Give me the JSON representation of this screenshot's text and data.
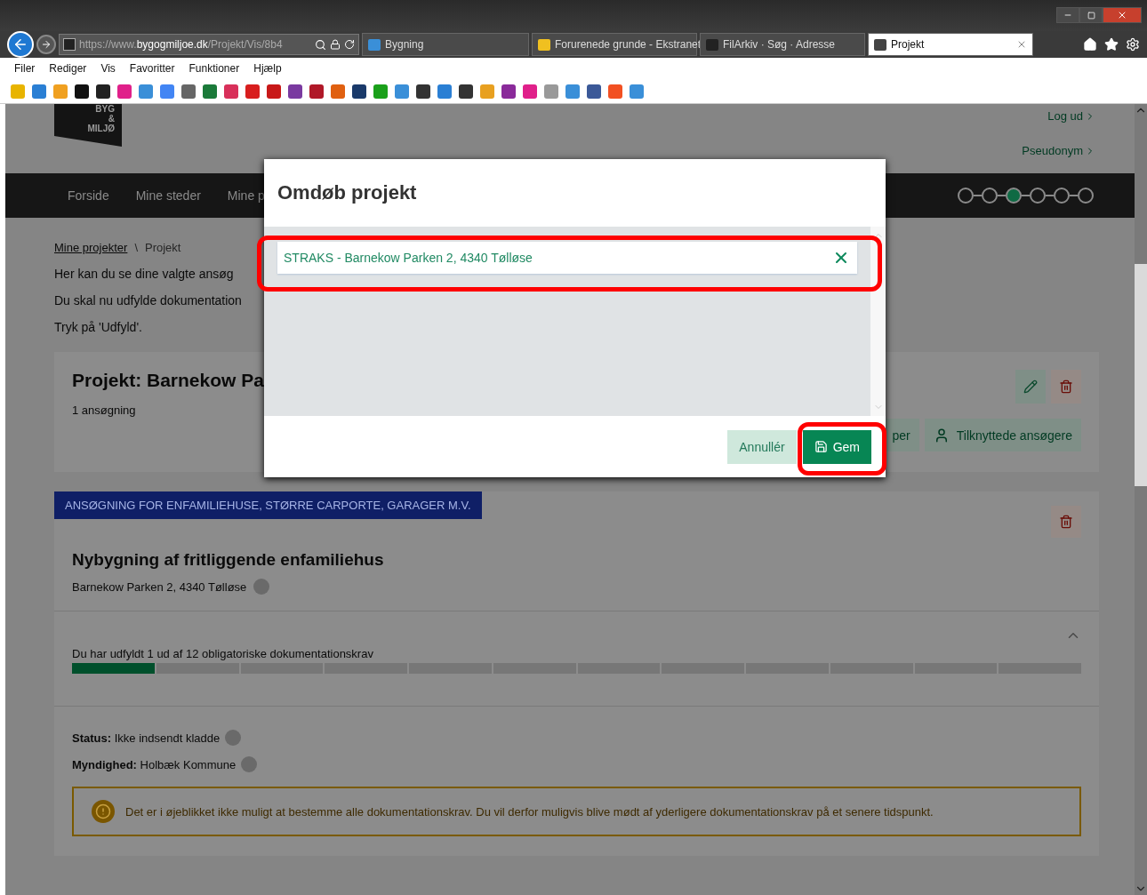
{
  "browser": {
    "address": {
      "prefix": "https://www.",
      "domain": "bygogmiljoe.dk",
      "path": "/Projekt/Vis/8b4"
    },
    "tabs": [
      {
        "label": "Bygning",
        "selected": false
      },
      {
        "label": "Forurenede grunde - Ekstranet",
        "selected": false
      },
      {
        "label": "FilArkiv · Søg · Adresse",
        "selected": false
      },
      {
        "label": "Projekt",
        "selected": true
      }
    ],
    "menu": [
      "Filer",
      "Rediger",
      "Vis",
      "Favoritter",
      "Funktioner",
      "Hjælp"
    ],
    "favorites": [
      {
        "color": "#e8b400"
      },
      {
        "color": "#2a7fd4"
      },
      {
        "color": "#f0a020"
      },
      {
        "color": "#111111"
      },
      {
        "color": "#222222"
      },
      {
        "color": "#e0208a"
      },
      {
        "color": "#3a8fd8"
      },
      {
        "color": "#4285f4"
      },
      {
        "color": "#666666"
      },
      {
        "color": "#1b7a3a"
      },
      {
        "color": "#d8305a"
      },
      {
        "color": "#d81e1e"
      },
      {
        "color": "#c81818"
      },
      {
        "color": "#7a3aa0"
      },
      {
        "color": "#b01828"
      },
      {
        "color": "#e06010"
      },
      {
        "color": "#1a3a6a"
      },
      {
        "color": "#1aa01a"
      },
      {
        "color": "#3a8fd8"
      },
      {
        "color": "#333333"
      },
      {
        "color": "#2a7fd4"
      },
      {
        "color": "#333333"
      },
      {
        "color": "#e8a020"
      },
      {
        "color": "#8a2a9a"
      },
      {
        "color": "#e0208a"
      },
      {
        "color": "#999999"
      },
      {
        "color": "#3a8fd8"
      },
      {
        "color": "#3b5998"
      },
      {
        "color": "#f25022"
      },
      {
        "color": "#3a8fd8"
      }
    ]
  },
  "header": {
    "logo": [
      "BYG",
      "&",
      "MILJØ"
    ],
    "links": [
      "Log ud",
      "Pseudonym"
    ]
  },
  "nav": {
    "items": [
      "Forside",
      "Mine steder",
      "Mine p"
    ],
    "steps": [
      {
        "selected": false
      },
      {
        "selected": false
      },
      {
        "selected": true
      },
      {
        "selected": false
      },
      {
        "selected": false
      },
      {
        "selected": false
      }
    ]
  },
  "breadcrumb": {
    "items": [
      "Mine projekter",
      "Projekt"
    ],
    "separator": "\\"
  },
  "intro": [
    "Her kan du se dine valgte ansøg",
    "Du skal nu udfylde dokumentation",
    "Tryk på 'Udfyld'."
  ],
  "project_card": {
    "title": "Projekt: Barnekow Pa",
    "subtitle": "1 ansøgning",
    "buttons": [
      {
        "label": "per",
        "kind": "plain"
      },
      {
        "label": "Tilknyttede ansøgere",
        "kind": "user"
      }
    ]
  },
  "application_card": {
    "tag": "ANSØGNING FOR ENFAMILIEHUSE, STØRRE CARPORTE, GARAGER M.V.",
    "title": "Nybygning af fritliggende enfamiliehus",
    "address": "Barnekow Parken 2, 4340 Tølløse",
    "progress": {
      "text": "Du har udfyldt 1 ud af 12 obligatoriske dokumentationskrav",
      "segments": [
        {
          "filled": true
        },
        {
          "filled": false
        },
        {
          "filled": false
        },
        {
          "filled": false
        },
        {
          "filled": false
        },
        {
          "filled": false
        },
        {
          "filled": false
        },
        {
          "filled": false
        },
        {
          "filled": false
        },
        {
          "filled": false
        },
        {
          "filled": false
        },
        {
          "filled": false
        }
      ]
    },
    "details": [
      {
        "label": "Status:",
        "value": "Ikke indsendt kladde"
      },
      {
        "label": "Myndighed:",
        "value": "Holbæk Kommune"
      }
    ],
    "warning": "Det er i øjeblikket ikke muligt at bestemme alle dokumentationskrav. Du vil derfor muligvis blive mødt af yderligere dokumentationskrav på et senere tidspunkt."
  },
  "dialog": {
    "title": "Omdøb projekt",
    "input": {
      "value": "STRAKS - Barnekow Parken 2, 4340 Tølløse"
    },
    "buttons": [
      {
        "label": "Annullér",
        "kind": "secondary"
      },
      {
        "label": "Gem",
        "kind": "primary"
      }
    ]
  }
}
